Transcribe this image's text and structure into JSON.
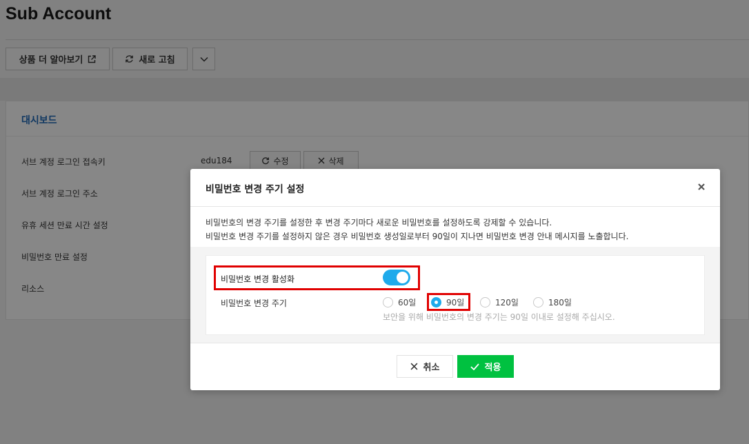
{
  "page": {
    "title": "Sub Account"
  },
  "toolbar": {
    "learn_more_label": "상품 더 알아보기",
    "refresh_label": "새로 고침"
  },
  "dashboard": {
    "title": "대시보드",
    "rows": [
      "서브 계정 로그인 접속키",
      "서브 계정 로그인 주소",
      "유휴 세션 만료 시간 설정",
      "비밀번호 만료 설정",
      "리소스"
    ],
    "access_key_value": "edu184",
    "edit_label": "수정",
    "delete_label": "삭제"
  },
  "modal": {
    "title": "비밀번호 변경 주기 설정",
    "description_line1": "비밀번호의 변경 주기를 설정한 후 변경 주기마다 새로운 비밀번호를 설정하도록 강제할 수 있습니다.",
    "description_line2": "비밀번호 변경 주기를 설정하지 않은 경우 비밀번호 생성일로부터 90일이 지나면 비밀번호 변경 안내 메시지를 노출합니다.",
    "toggle_label": "비밀번호 변경 활성화",
    "toggle_on": true,
    "cycle_label": "비밀번호 변경 주기",
    "options": [
      "60일",
      "90일",
      "120일",
      "180일"
    ],
    "selected_option": "90일",
    "hint": "보안을 위해 비밀번호의 변경 주기는 90일 이내로 설정해 주십시오.",
    "cancel_label": "취소",
    "apply_label": "적용"
  },
  "colors": {
    "accent_blue": "#1eaaeb",
    "apply_green": "#00c140",
    "highlight_red": "#e00000",
    "link_blue": "#1d68b8"
  }
}
